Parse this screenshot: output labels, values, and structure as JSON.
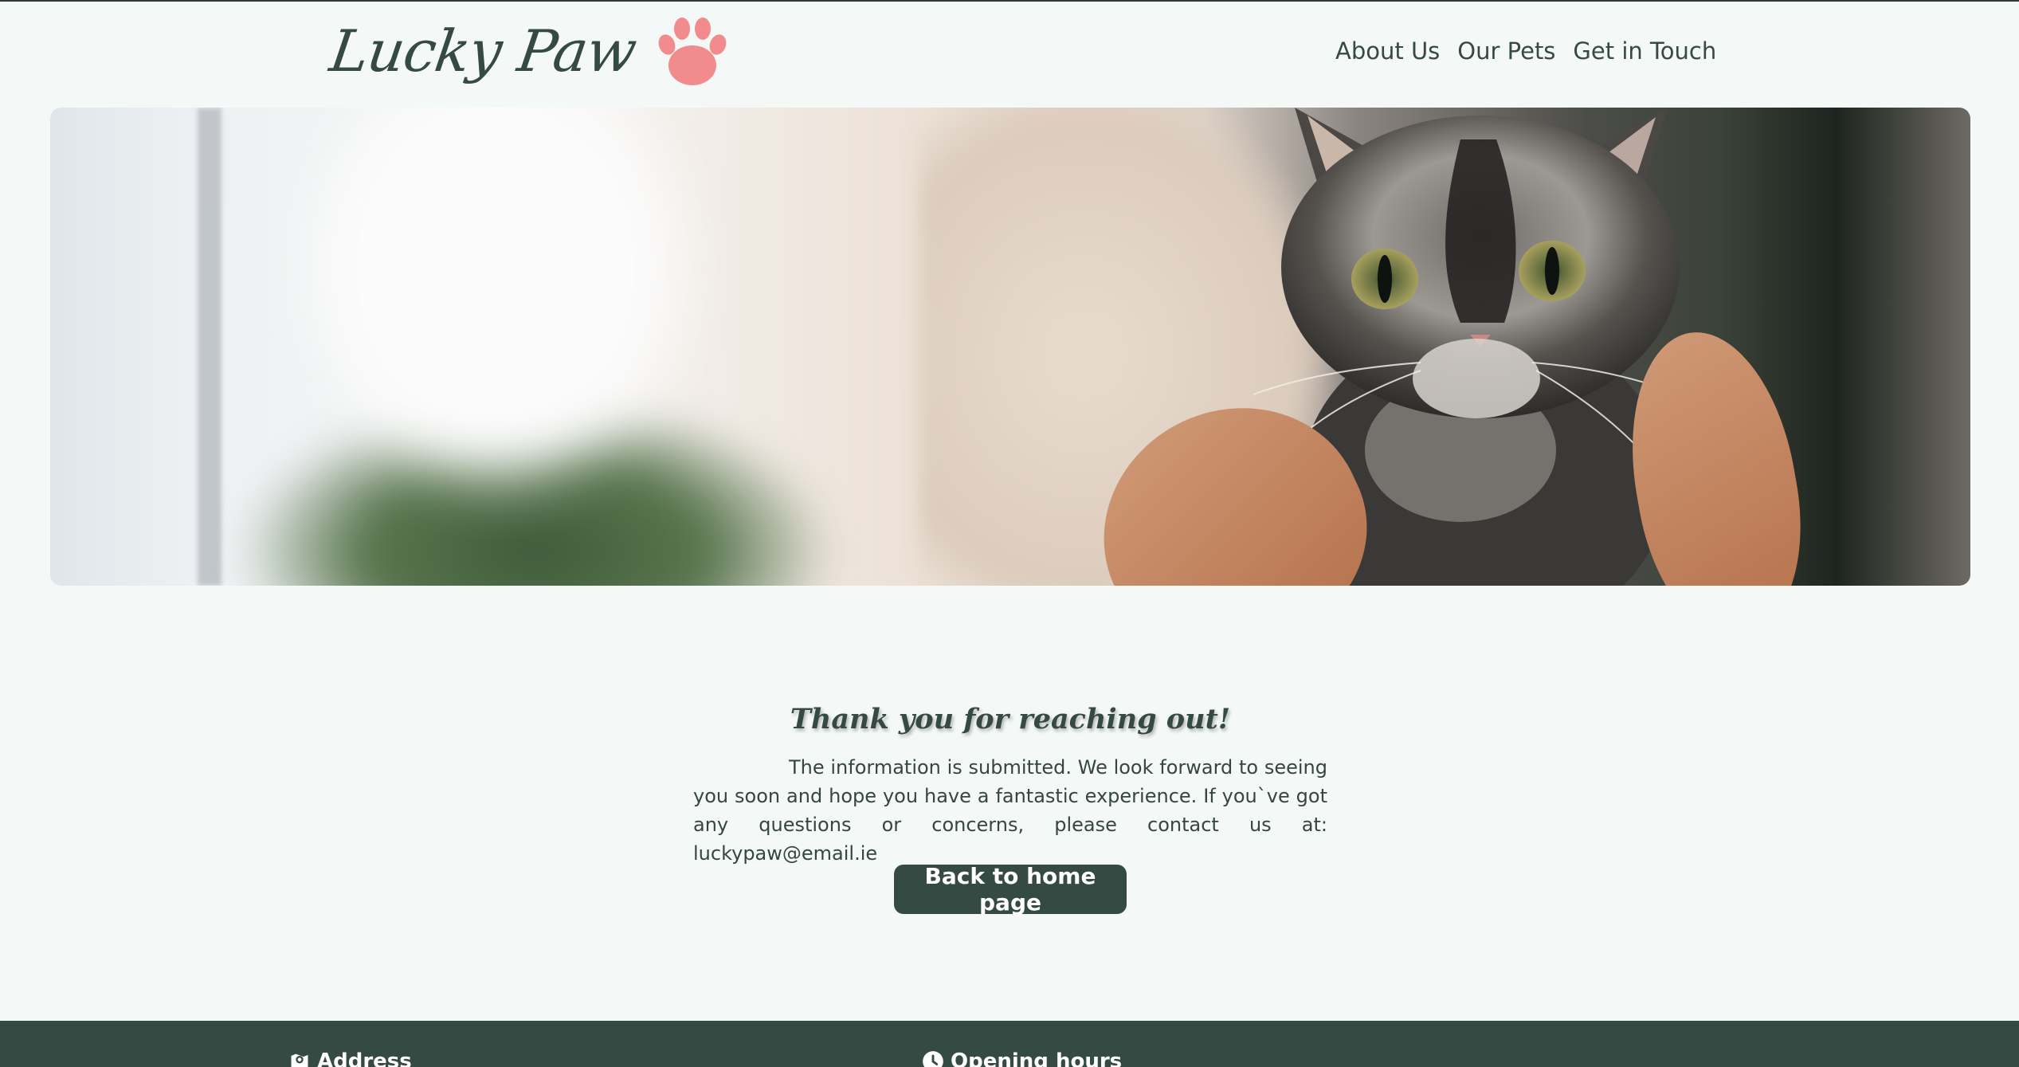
{
  "header": {
    "logo_text": "Lucky Paw",
    "logo_icon": "paw-icon",
    "nav": [
      {
        "label": "About Us"
      },
      {
        "label": "Our Pets"
      },
      {
        "label": "Get in Touch"
      }
    ]
  },
  "hero": {
    "image": "woman-holding-tortoiseshell-cat"
  },
  "thanks": {
    "heading": "Thank you for reaching out!",
    "body": "The information is submitted. We look forward to seeing you soon and hope you have a fantastic experience. If you`ve got any questions or concerns, please contact us at: luckypaw@email.ie",
    "button_label": "Back to home page"
  },
  "footer": {
    "address_heading": "Address",
    "address_icon": "map-pin-icon",
    "hours_heading": "Opening hours",
    "hours_icon": "clock-icon"
  },
  "colors": {
    "primary": "#344a43",
    "background": "#f4f8f7",
    "paw": "#f28b8b"
  }
}
